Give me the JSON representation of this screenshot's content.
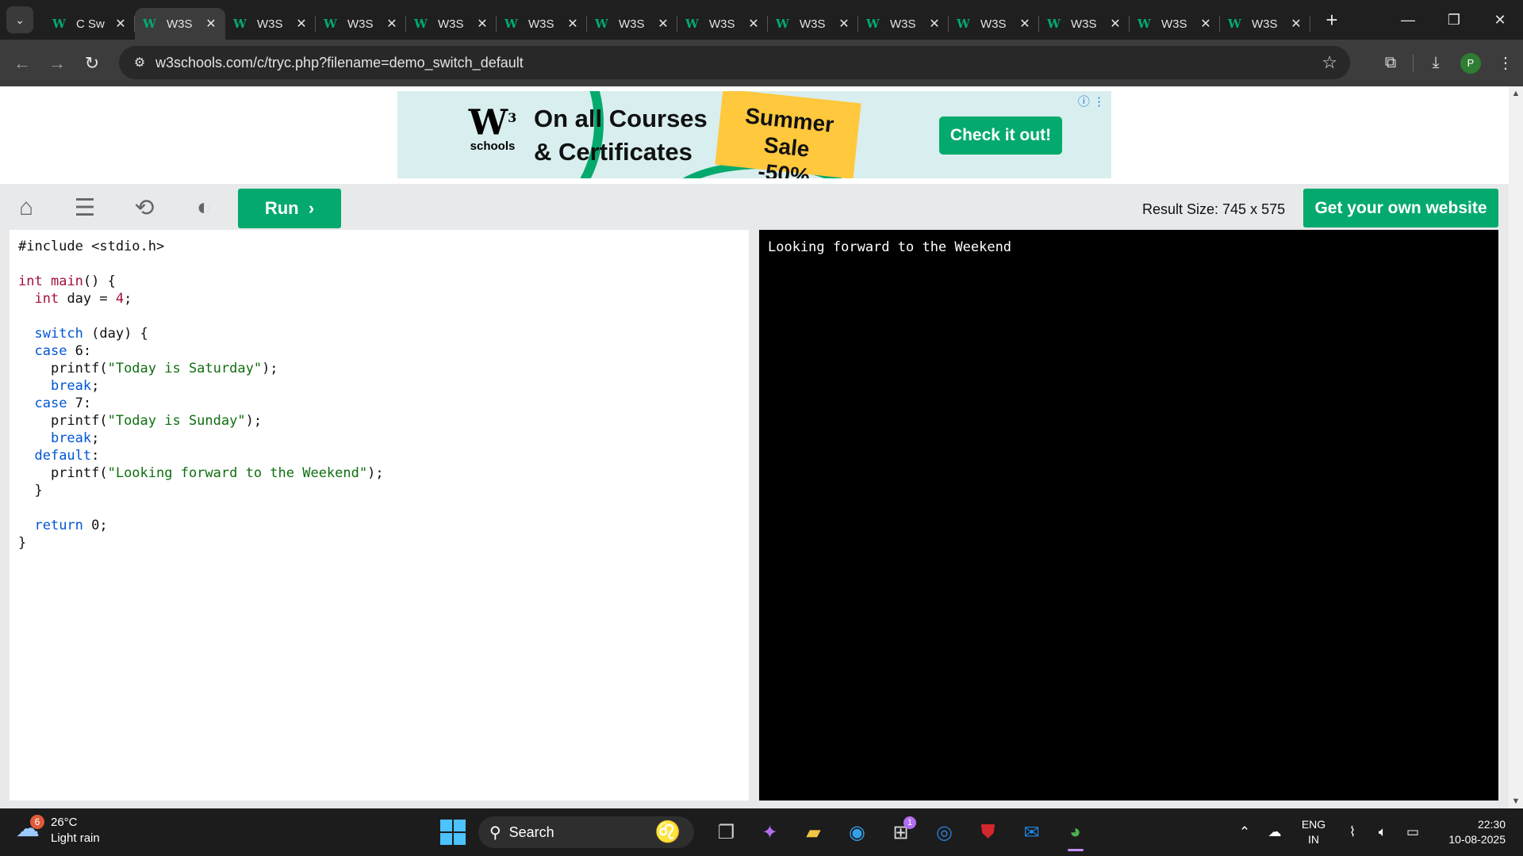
{
  "browser": {
    "tabs": [
      {
        "title": "C Sw",
        "active": false
      },
      {
        "title": "W3S",
        "active": true
      },
      {
        "title": "W3S",
        "active": false
      },
      {
        "title": "W3S",
        "active": false
      },
      {
        "title": "W3S",
        "active": false
      },
      {
        "title": "W3S",
        "active": false
      },
      {
        "title": "W3S",
        "active": false
      },
      {
        "title": "W3S",
        "active": false
      },
      {
        "title": "W3S",
        "active": false
      },
      {
        "title": "W3S",
        "active": false
      },
      {
        "title": "W3S",
        "active": false
      },
      {
        "title": "W3S",
        "active": false
      },
      {
        "title": "W3S",
        "active": false
      },
      {
        "title": "W3S",
        "active": false
      }
    ],
    "url": "w3schools.com/c/tryc.php?filename=demo_switch_default",
    "profile_initial": "P"
  },
  "ad": {
    "logo_mark": "W",
    "logo_sup": "3",
    "logo_text": "schools",
    "headline_1": "On all Courses",
    "headline_2": "& Certificates",
    "sale_1": "Summer Sale",
    "sale_2": "-50%",
    "cta": "Check it out!"
  },
  "editor": {
    "run_label": "Run",
    "result_size": "Result Size: 745 x 575",
    "get_website": "Get your own website",
    "code_lines": [
      "#include <stdio.h>",
      "",
      "int main() {",
      "  int day = 4;",
      "",
      "  switch (day) {",
      "  case 6:",
      "    printf(\"Today is Saturday\");",
      "    break;",
      "  case 7:",
      "    printf(\"Today is Sunday\");",
      "    break;",
      "  default:",
      "    printf(\"Looking forward to the Weekend\");",
      "  }",
      "",
      "  return 0;",
      "}"
    ],
    "output": "Looking forward to the Weekend"
  },
  "taskbar": {
    "weather_badge": "6",
    "temperature": "26°C",
    "condition": "Light rain",
    "search_label": "Search",
    "store_badge": "1",
    "lang_1": "ENG",
    "lang_2": "IN",
    "time": "22:30",
    "date": "10-08-2025"
  },
  "colors": {
    "accent": "#04aa6d",
    "keyword": "#0055d4",
    "type": "#a4113a",
    "string": "#0f6f0f"
  }
}
